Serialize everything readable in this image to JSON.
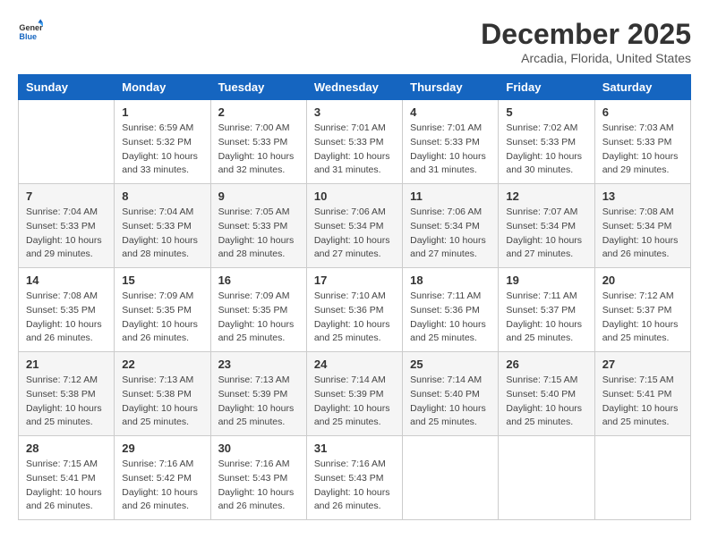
{
  "logo": {
    "general": "General",
    "blue": "Blue"
  },
  "header": {
    "title": "December 2025",
    "subtitle": "Arcadia, Florida, United States"
  },
  "columns": [
    "Sunday",
    "Monday",
    "Tuesday",
    "Wednesday",
    "Thursday",
    "Friday",
    "Saturday"
  ],
  "weeks": [
    [
      {
        "day": "",
        "info": ""
      },
      {
        "day": "1",
        "info": "Sunrise: 6:59 AM\nSunset: 5:32 PM\nDaylight: 10 hours\nand 33 minutes."
      },
      {
        "day": "2",
        "info": "Sunrise: 7:00 AM\nSunset: 5:33 PM\nDaylight: 10 hours\nand 32 minutes."
      },
      {
        "day": "3",
        "info": "Sunrise: 7:01 AM\nSunset: 5:33 PM\nDaylight: 10 hours\nand 31 minutes."
      },
      {
        "day": "4",
        "info": "Sunrise: 7:01 AM\nSunset: 5:33 PM\nDaylight: 10 hours\nand 31 minutes."
      },
      {
        "day": "5",
        "info": "Sunrise: 7:02 AM\nSunset: 5:33 PM\nDaylight: 10 hours\nand 30 minutes."
      },
      {
        "day": "6",
        "info": "Sunrise: 7:03 AM\nSunset: 5:33 PM\nDaylight: 10 hours\nand 29 minutes."
      }
    ],
    [
      {
        "day": "7",
        "info": "Sunrise: 7:04 AM\nSunset: 5:33 PM\nDaylight: 10 hours\nand 29 minutes."
      },
      {
        "day": "8",
        "info": "Sunrise: 7:04 AM\nSunset: 5:33 PM\nDaylight: 10 hours\nand 28 minutes."
      },
      {
        "day": "9",
        "info": "Sunrise: 7:05 AM\nSunset: 5:33 PM\nDaylight: 10 hours\nand 28 minutes."
      },
      {
        "day": "10",
        "info": "Sunrise: 7:06 AM\nSunset: 5:34 PM\nDaylight: 10 hours\nand 27 minutes."
      },
      {
        "day": "11",
        "info": "Sunrise: 7:06 AM\nSunset: 5:34 PM\nDaylight: 10 hours\nand 27 minutes."
      },
      {
        "day": "12",
        "info": "Sunrise: 7:07 AM\nSunset: 5:34 PM\nDaylight: 10 hours\nand 27 minutes."
      },
      {
        "day": "13",
        "info": "Sunrise: 7:08 AM\nSunset: 5:34 PM\nDaylight: 10 hours\nand 26 minutes."
      }
    ],
    [
      {
        "day": "14",
        "info": "Sunrise: 7:08 AM\nSunset: 5:35 PM\nDaylight: 10 hours\nand 26 minutes."
      },
      {
        "day": "15",
        "info": "Sunrise: 7:09 AM\nSunset: 5:35 PM\nDaylight: 10 hours\nand 26 minutes."
      },
      {
        "day": "16",
        "info": "Sunrise: 7:09 AM\nSunset: 5:35 PM\nDaylight: 10 hours\nand 25 minutes."
      },
      {
        "day": "17",
        "info": "Sunrise: 7:10 AM\nSunset: 5:36 PM\nDaylight: 10 hours\nand 25 minutes."
      },
      {
        "day": "18",
        "info": "Sunrise: 7:11 AM\nSunset: 5:36 PM\nDaylight: 10 hours\nand 25 minutes."
      },
      {
        "day": "19",
        "info": "Sunrise: 7:11 AM\nSunset: 5:37 PM\nDaylight: 10 hours\nand 25 minutes."
      },
      {
        "day": "20",
        "info": "Sunrise: 7:12 AM\nSunset: 5:37 PM\nDaylight: 10 hours\nand 25 minutes."
      }
    ],
    [
      {
        "day": "21",
        "info": "Sunrise: 7:12 AM\nSunset: 5:38 PM\nDaylight: 10 hours\nand 25 minutes."
      },
      {
        "day": "22",
        "info": "Sunrise: 7:13 AM\nSunset: 5:38 PM\nDaylight: 10 hours\nand 25 minutes."
      },
      {
        "day": "23",
        "info": "Sunrise: 7:13 AM\nSunset: 5:39 PM\nDaylight: 10 hours\nand 25 minutes."
      },
      {
        "day": "24",
        "info": "Sunrise: 7:14 AM\nSunset: 5:39 PM\nDaylight: 10 hours\nand 25 minutes."
      },
      {
        "day": "25",
        "info": "Sunrise: 7:14 AM\nSunset: 5:40 PM\nDaylight: 10 hours\nand 25 minutes."
      },
      {
        "day": "26",
        "info": "Sunrise: 7:15 AM\nSunset: 5:40 PM\nDaylight: 10 hours\nand 25 minutes."
      },
      {
        "day": "27",
        "info": "Sunrise: 7:15 AM\nSunset: 5:41 PM\nDaylight: 10 hours\nand 25 minutes."
      }
    ],
    [
      {
        "day": "28",
        "info": "Sunrise: 7:15 AM\nSunset: 5:41 PM\nDaylight: 10 hours\nand 26 minutes."
      },
      {
        "day": "29",
        "info": "Sunrise: 7:16 AM\nSunset: 5:42 PM\nDaylight: 10 hours\nand 26 minutes."
      },
      {
        "day": "30",
        "info": "Sunrise: 7:16 AM\nSunset: 5:43 PM\nDaylight: 10 hours\nand 26 minutes."
      },
      {
        "day": "31",
        "info": "Sunrise: 7:16 AM\nSunset: 5:43 PM\nDaylight: 10 hours\nand 26 minutes."
      },
      {
        "day": "",
        "info": ""
      },
      {
        "day": "",
        "info": ""
      },
      {
        "day": "",
        "info": ""
      }
    ]
  ]
}
